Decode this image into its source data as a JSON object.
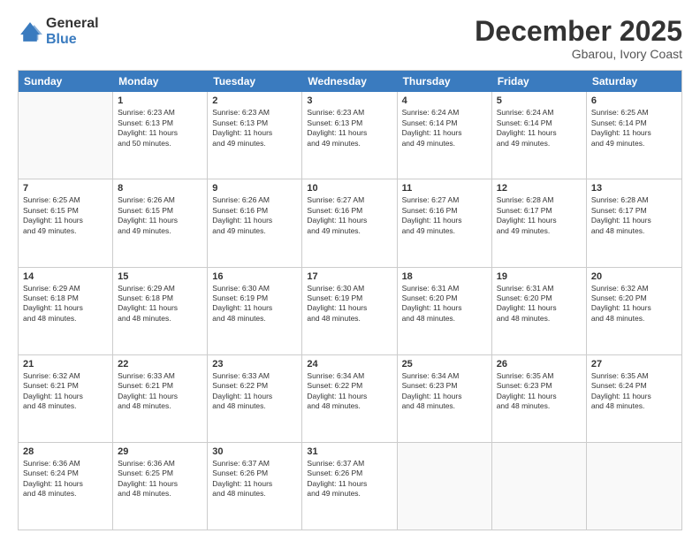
{
  "logo": {
    "general": "General",
    "blue": "Blue"
  },
  "header": {
    "month": "December 2025",
    "location": "Gbarou, Ivory Coast"
  },
  "days": [
    "Sunday",
    "Monday",
    "Tuesday",
    "Wednesday",
    "Thursday",
    "Friday",
    "Saturday"
  ],
  "weeks": [
    [
      {
        "day": "",
        "content": ""
      },
      {
        "day": "1",
        "content": "Sunrise: 6:23 AM\nSunset: 6:13 PM\nDaylight: 11 hours\nand 50 minutes."
      },
      {
        "day": "2",
        "content": "Sunrise: 6:23 AM\nSunset: 6:13 PM\nDaylight: 11 hours\nand 49 minutes."
      },
      {
        "day": "3",
        "content": "Sunrise: 6:23 AM\nSunset: 6:13 PM\nDaylight: 11 hours\nand 49 minutes."
      },
      {
        "day": "4",
        "content": "Sunrise: 6:24 AM\nSunset: 6:14 PM\nDaylight: 11 hours\nand 49 minutes."
      },
      {
        "day": "5",
        "content": "Sunrise: 6:24 AM\nSunset: 6:14 PM\nDaylight: 11 hours\nand 49 minutes."
      },
      {
        "day": "6",
        "content": "Sunrise: 6:25 AM\nSunset: 6:14 PM\nDaylight: 11 hours\nand 49 minutes."
      }
    ],
    [
      {
        "day": "7",
        "content": "Sunrise: 6:25 AM\nSunset: 6:15 PM\nDaylight: 11 hours\nand 49 minutes."
      },
      {
        "day": "8",
        "content": "Sunrise: 6:26 AM\nSunset: 6:15 PM\nDaylight: 11 hours\nand 49 minutes."
      },
      {
        "day": "9",
        "content": "Sunrise: 6:26 AM\nSunset: 6:16 PM\nDaylight: 11 hours\nand 49 minutes."
      },
      {
        "day": "10",
        "content": "Sunrise: 6:27 AM\nSunset: 6:16 PM\nDaylight: 11 hours\nand 49 minutes."
      },
      {
        "day": "11",
        "content": "Sunrise: 6:27 AM\nSunset: 6:16 PM\nDaylight: 11 hours\nand 49 minutes."
      },
      {
        "day": "12",
        "content": "Sunrise: 6:28 AM\nSunset: 6:17 PM\nDaylight: 11 hours\nand 49 minutes."
      },
      {
        "day": "13",
        "content": "Sunrise: 6:28 AM\nSunset: 6:17 PM\nDaylight: 11 hours\nand 48 minutes."
      }
    ],
    [
      {
        "day": "14",
        "content": "Sunrise: 6:29 AM\nSunset: 6:18 PM\nDaylight: 11 hours\nand 48 minutes."
      },
      {
        "day": "15",
        "content": "Sunrise: 6:29 AM\nSunset: 6:18 PM\nDaylight: 11 hours\nand 48 minutes."
      },
      {
        "day": "16",
        "content": "Sunrise: 6:30 AM\nSunset: 6:19 PM\nDaylight: 11 hours\nand 48 minutes."
      },
      {
        "day": "17",
        "content": "Sunrise: 6:30 AM\nSunset: 6:19 PM\nDaylight: 11 hours\nand 48 minutes."
      },
      {
        "day": "18",
        "content": "Sunrise: 6:31 AM\nSunset: 6:20 PM\nDaylight: 11 hours\nand 48 minutes."
      },
      {
        "day": "19",
        "content": "Sunrise: 6:31 AM\nSunset: 6:20 PM\nDaylight: 11 hours\nand 48 minutes."
      },
      {
        "day": "20",
        "content": "Sunrise: 6:32 AM\nSunset: 6:20 PM\nDaylight: 11 hours\nand 48 minutes."
      }
    ],
    [
      {
        "day": "21",
        "content": "Sunrise: 6:32 AM\nSunset: 6:21 PM\nDaylight: 11 hours\nand 48 minutes."
      },
      {
        "day": "22",
        "content": "Sunrise: 6:33 AM\nSunset: 6:21 PM\nDaylight: 11 hours\nand 48 minutes."
      },
      {
        "day": "23",
        "content": "Sunrise: 6:33 AM\nSunset: 6:22 PM\nDaylight: 11 hours\nand 48 minutes."
      },
      {
        "day": "24",
        "content": "Sunrise: 6:34 AM\nSunset: 6:22 PM\nDaylight: 11 hours\nand 48 minutes."
      },
      {
        "day": "25",
        "content": "Sunrise: 6:34 AM\nSunset: 6:23 PM\nDaylight: 11 hours\nand 48 minutes."
      },
      {
        "day": "26",
        "content": "Sunrise: 6:35 AM\nSunset: 6:23 PM\nDaylight: 11 hours\nand 48 minutes."
      },
      {
        "day": "27",
        "content": "Sunrise: 6:35 AM\nSunset: 6:24 PM\nDaylight: 11 hours\nand 48 minutes."
      }
    ],
    [
      {
        "day": "28",
        "content": "Sunrise: 6:36 AM\nSunset: 6:24 PM\nDaylight: 11 hours\nand 48 minutes."
      },
      {
        "day": "29",
        "content": "Sunrise: 6:36 AM\nSunset: 6:25 PM\nDaylight: 11 hours\nand 48 minutes."
      },
      {
        "day": "30",
        "content": "Sunrise: 6:37 AM\nSunset: 6:26 PM\nDaylight: 11 hours\nand 48 minutes."
      },
      {
        "day": "31",
        "content": "Sunrise: 6:37 AM\nSunset: 6:26 PM\nDaylight: 11 hours\nand 49 minutes."
      },
      {
        "day": "",
        "content": ""
      },
      {
        "day": "",
        "content": ""
      },
      {
        "day": "",
        "content": ""
      }
    ]
  ]
}
